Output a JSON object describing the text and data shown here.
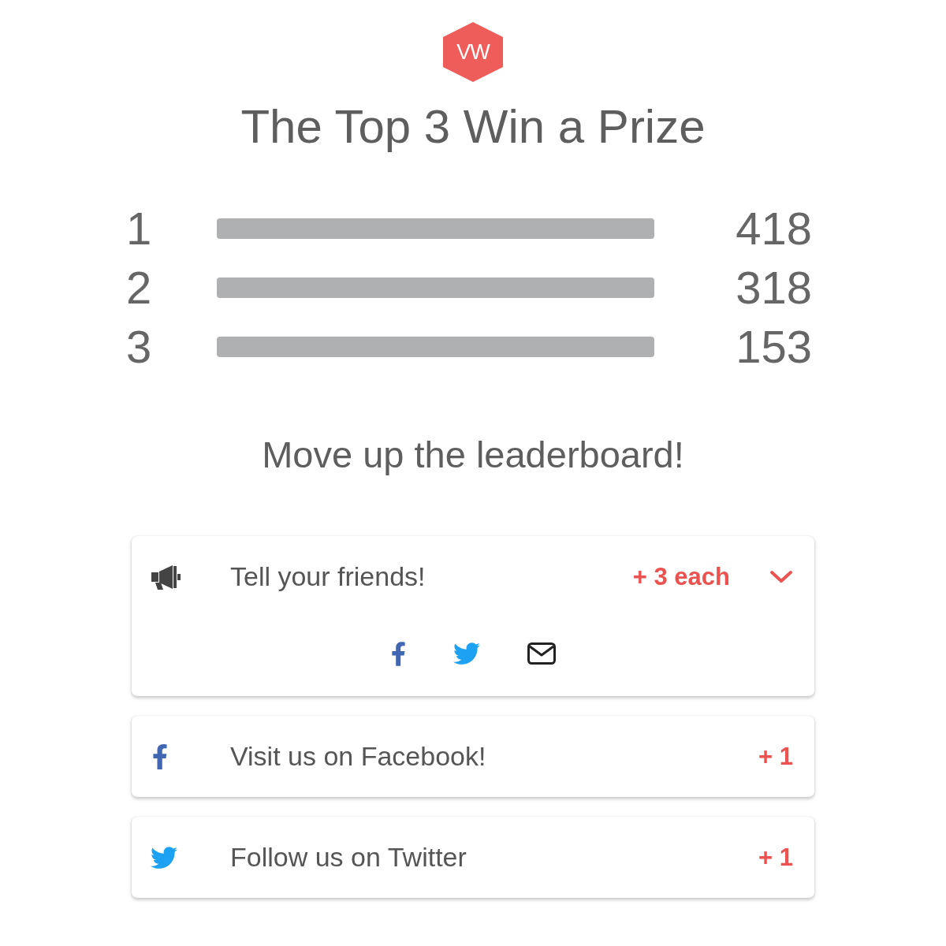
{
  "logo": {
    "text": "VW"
  },
  "title": "The Top 3 Win a Prize",
  "leaderboard": [
    {
      "rank": "1",
      "score": "418"
    },
    {
      "rank": "2",
      "score": "318"
    },
    {
      "rank": "3",
      "score": "153"
    }
  ],
  "prompt": "Move up the leaderboard!",
  "tasks": [
    {
      "kind": "share",
      "label": "Tell your friends!",
      "points": "+ 3 each",
      "expanded": true,
      "share_links": [
        {
          "kind": "facebook"
        },
        {
          "kind": "twitter"
        },
        {
          "kind": "email"
        }
      ]
    },
    {
      "kind": "facebook",
      "label": "Visit us on Facebook!",
      "points": "+ 1"
    },
    {
      "kind": "twitter",
      "label": "Follow us on Twitter",
      "points": "+ 1"
    }
  ]
}
